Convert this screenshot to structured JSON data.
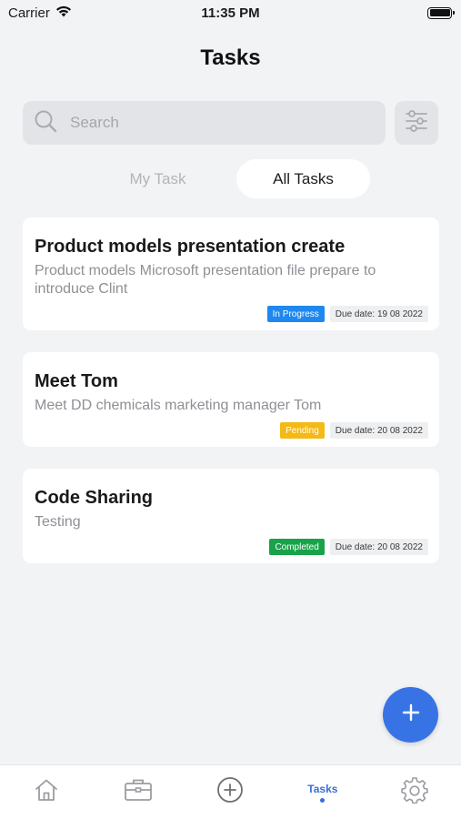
{
  "status": {
    "carrier": "Carrier",
    "time": "11:35 PM"
  },
  "header": {
    "title": "Tasks"
  },
  "search": {
    "placeholder": "Search",
    "value": ""
  },
  "segments": {
    "my_task": "My Task",
    "all_tasks": "All Tasks",
    "selected": "All Tasks"
  },
  "tasks": [
    {
      "title": "Product models presentation create",
      "description": "Product models Microsoft presentation file prepare to introduce Clint",
      "status": "In Progress",
      "status_color": "#1e88f0",
      "due": "Due date: 19 08 2022"
    },
    {
      "title": "Meet Tom",
      "description": "Meet DD chemicals marketing manager Tom",
      "status": "Pending",
      "status_color": "#f5b915",
      "due": "Due date: 20 08 2022"
    },
    {
      "title": "Code Sharing",
      "description": "Testing",
      "status": "Completed",
      "status_color": "#18a34a",
      "due": "Due date: 20 08 2022"
    }
  ],
  "tabbar": {
    "items": [
      {
        "icon": "home-icon"
      },
      {
        "icon": "briefcase-icon"
      },
      {
        "icon": "add-circle-icon"
      },
      {
        "label": "Tasks",
        "selected": true
      },
      {
        "icon": "gear-icon"
      }
    ]
  },
  "colors": {
    "accent": "#3873e6",
    "background": "#f2f3f5"
  }
}
